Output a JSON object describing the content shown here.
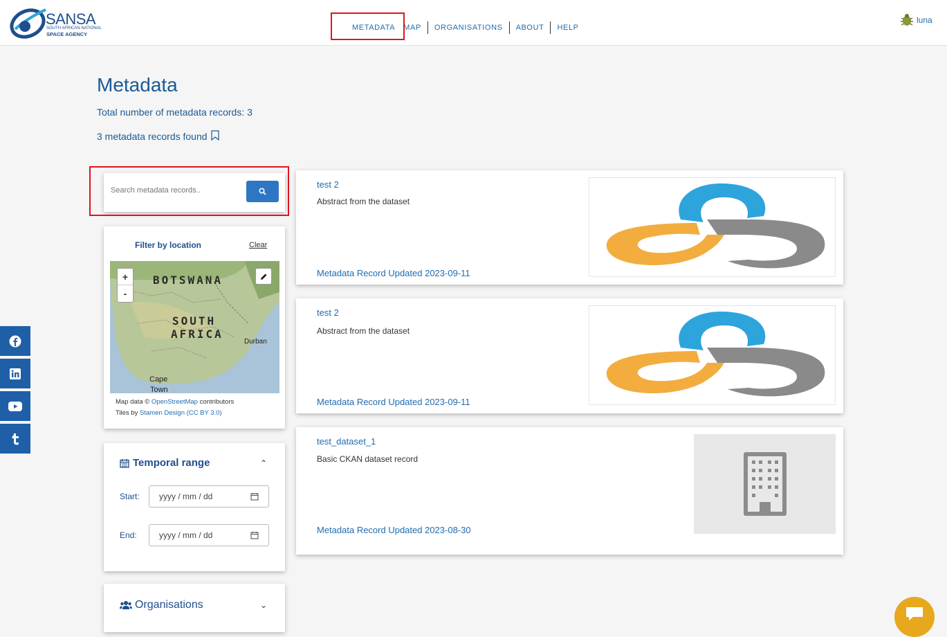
{
  "header": {
    "brand": "SANSA",
    "brand_sub": "SOUTH AFRICAN NATIONAL",
    "brand_sub2": "SPACE AGENCY",
    "nav": [
      "METADATA",
      "MAP",
      "ORGANISATIONS",
      "ABOUT",
      "HELP"
    ],
    "user": "luna"
  },
  "social": [
    "facebook-icon",
    "linkedin-icon",
    "youtube-icon",
    "tumblr-icon"
  ],
  "main": {
    "title": "Metadata",
    "total": "Total number of metadata records: 3",
    "found": "3 metadata records found"
  },
  "search": {
    "placeholder": "Search metadata records.."
  },
  "filter": {
    "title": "Filter by location",
    "clear": "Clear",
    "map_labels": [
      "BOTSWANA",
      "SOUTH",
      "AFRICA",
      "Durban",
      "Cape",
      "Town"
    ],
    "attribution1_pre": "Map data ©",
    "attribution1_link": "OpenStreetMap",
    "attribution1_post": "contributors",
    "attribution2_pre": "Tiles by",
    "attribution2_link": "Stamen Design",
    "attribution2_link2": "(CC BY 3.0)"
  },
  "temporal": {
    "title": "Temporal range",
    "start_label": "Start:",
    "end_label": "End:",
    "start_placeholder": "yyyy / mm / dd",
    "end_placeholder": "yyyy / mm / dd"
  },
  "orgs": {
    "title": "Organisations"
  },
  "records": [
    {
      "title": "test 2",
      "abstract": "Abstract from the dataset",
      "updated": "Metadata Record Updated 2023-09-11"
    },
    {
      "title": "test 2",
      "abstract": "Abstract from the dataset",
      "updated": "Metadata Record Updated 2023-09-11"
    },
    {
      "title": "test_dataset_1",
      "abstract": "Basic CKAN dataset record",
      "updated": "Metadata Record Updated 2023-08-30"
    }
  ],
  "colors": {
    "accent": "#1f5fa8",
    "button": "#2e76c4",
    "highlight": "#e0141e",
    "chat": "#e7a81e"
  }
}
